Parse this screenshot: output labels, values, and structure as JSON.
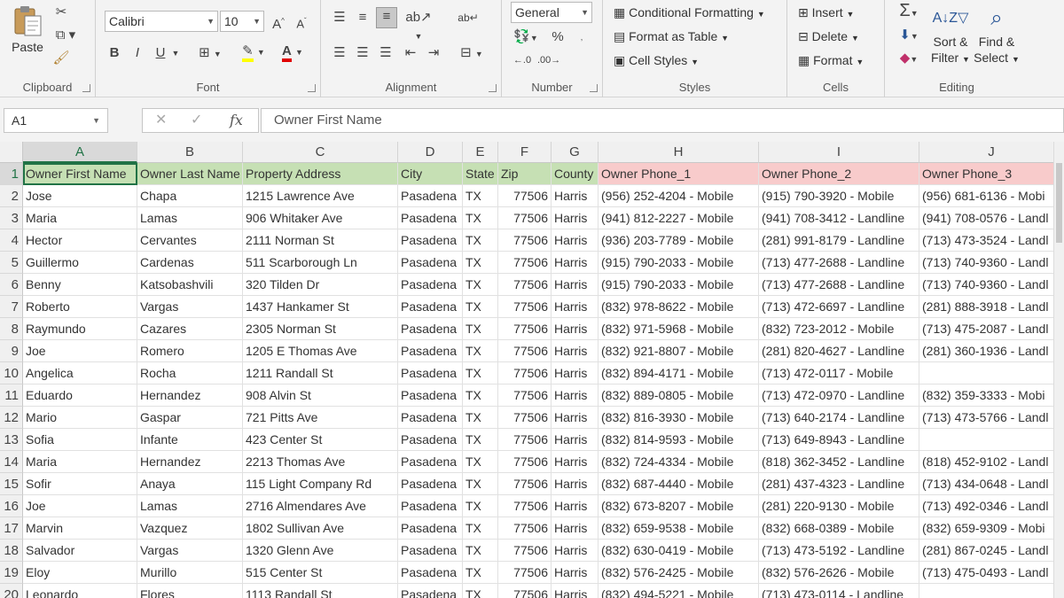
{
  "ribbon": {
    "clipboard": {
      "paste": "Paste",
      "label": "Clipboard"
    },
    "font": {
      "name": "Calibri",
      "size": "10",
      "bold": "B",
      "italic": "I",
      "underline": "U",
      "label": "Font"
    },
    "alignment": {
      "label": "Alignment"
    },
    "number": {
      "format": "General",
      "label": "Number"
    },
    "styles": {
      "conditional": "Conditional Formatting",
      "table": "Format as Table",
      "cell": "Cell Styles",
      "label": "Styles"
    },
    "cells": {
      "insert": "Insert",
      "delete": "Delete",
      "format": "Format",
      "label": "Cells"
    },
    "editing": {
      "sort1": "Sort &",
      "sort2": "Filter",
      "find1": "Find &",
      "find2": "Select",
      "label": "Editing"
    }
  },
  "formula_bar": {
    "name_box": "A1",
    "content": "Owner First Name"
  },
  "columns": [
    "A",
    "B",
    "C",
    "D",
    "E",
    "F",
    "G",
    "H",
    "I",
    "J"
  ],
  "headers": [
    "Owner First Name",
    "Owner Last Name",
    "Property Address",
    "City",
    "State",
    "Zip",
    "County",
    "Owner Phone_1",
    "Owner Phone_2",
    "Owner Phone_3"
  ],
  "rows": [
    [
      "2",
      "Jose",
      "Chapa",
      "1215 Lawrence Ave",
      "Pasadena",
      "TX",
      "77506",
      "Harris",
      "(956) 252-4204 - Mobile",
      "(915) 790-3920 - Mobile",
      "(956) 681-6136 - Mobi"
    ],
    [
      "3",
      "Maria",
      "Lamas",
      "906 Whitaker Ave",
      "Pasadena",
      "TX",
      "77506",
      "Harris",
      "(941) 812-2227 - Mobile",
      "(941) 708-3412 - Landline",
      "(941) 708-0576 - Landl"
    ],
    [
      "4",
      "Hector",
      "Cervantes",
      "2111 Norman St",
      "Pasadena",
      "TX",
      "77506",
      "Harris",
      "(936) 203-7789 - Mobile",
      "(281) 991-8179 - Landline",
      "(713) 473-3524 - Landl"
    ],
    [
      "5",
      "Guillermo",
      "Cardenas",
      "511 Scarborough Ln",
      "Pasadena",
      "TX",
      "77506",
      "Harris",
      "(915) 790-2033 - Mobile",
      "(713) 477-2688 - Landline",
      "(713) 740-9360 - Landl"
    ],
    [
      "6",
      "Benny",
      "Katsobashvili",
      "320 Tilden Dr",
      "Pasadena",
      "TX",
      "77506",
      "Harris",
      "(915) 790-2033 - Mobile",
      "(713) 477-2688 - Landline",
      "(713) 740-9360 - Landl"
    ],
    [
      "7",
      "Roberto",
      "Vargas",
      "1437 Hankamer St",
      "Pasadena",
      "TX",
      "77506",
      "Harris",
      "(832) 978-8622 - Mobile",
      "(713) 472-6697 - Landline",
      "(281) 888-3918 - Landl"
    ],
    [
      "8",
      "Raymundo",
      "Cazares",
      "2305 Norman St",
      "Pasadena",
      "TX",
      "77506",
      "Harris",
      "(832) 971-5968 - Mobile",
      "(832) 723-2012 - Mobile",
      "(713) 475-2087 - Landl"
    ],
    [
      "9",
      "Joe",
      "Romero",
      "1205 E Thomas Ave",
      "Pasadena",
      "TX",
      "77506",
      "Harris",
      "(832) 921-8807 - Mobile",
      "(281) 820-4627 - Landline",
      "(281) 360-1936 - Landl"
    ],
    [
      "10",
      "Angelica",
      "Rocha",
      "1211 Randall St",
      "Pasadena",
      "TX",
      "77506",
      "Harris",
      "(832) 894-4171 - Mobile",
      "(713) 472-0117 - Mobile",
      ""
    ],
    [
      "11",
      "Eduardo",
      "Hernandez",
      "908 Alvin St",
      "Pasadena",
      "TX",
      "77506",
      "Harris",
      "(832) 889-0805 - Mobile",
      "(713) 472-0970 - Landline",
      "(832) 359-3333 - Mobi"
    ],
    [
      "12",
      "Mario",
      "Gaspar",
      "721 Pitts Ave",
      "Pasadena",
      "TX",
      "77506",
      "Harris",
      "(832) 816-3930 - Mobile",
      "(713) 640-2174 - Landline",
      "(713) 473-5766 - Landl"
    ],
    [
      "13",
      "Sofia",
      "Infante",
      "423 Center St",
      "Pasadena",
      "TX",
      "77506",
      "Harris",
      "(832) 814-9593 - Mobile",
      "(713) 649-8943 - Landline",
      ""
    ],
    [
      "14",
      "Maria",
      "Hernandez",
      "2213 Thomas Ave",
      "Pasadena",
      "TX",
      "77506",
      "Harris",
      "(832) 724-4334 - Mobile",
      "(818) 362-3452 - Landline",
      "(818) 452-9102 - Landl"
    ],
    [
      "15",
      "Sofir",
      "Anaya",
      "115 Light Company Rd",
      "Pasadena",
      "TX",
      "77506",
      "Harris",
      "(832) 687-4440 - Mobile",
      "(281) 437-4323 - Landline",
      "(713) 434-0648 - Landl"
    ],
    [
      "16",
      "Joe",
      "Lamas",
      "2716 Almendares Ave",
      "Pasadena",
      "TX",
      "77506",
      "Harris",
      "(832) 673-8207 - Mobile",
      "(281) 220-9130 - Mobile",
      "(713) 492-0346 - Landl"
    ],
    [
      "17",
      "Marvin",
      "Vazquez",
      "1802 Sullivan Ave",
      "Pasadena",
      "TX",
      "77506",
      "Harris",
      "(832) 659-9538 - Mobile",
      "(832) 668-0389 - Mobile",
      "(832) 659-9309 - Mobi"
    ],
    [
      "18",
      "Salvador",
      "Vargas",
      "1320 Glenn Ave",
      "Pasadena",
      "TX",
      "77506",
      "Harris",
      "(832) 630-0419 - Mobile",
      "(713) 473-5192 - Landline",
      "(281) 867-0245 - Landl"
    ],
    [
      "19",
      "Eloy",
      "Murillo",
      "515 Center St",
      "Pasadena",
      "TX",
      "77506",
      "Harris",
      "(832) 576-2425 - Mobile",
      "(832) 576-2626 - Mobile",
      "(713) 475-0493 - Landl"
    ],
    [
      "20",
      "Leonardo",
      "Flores",
      "1113 Randall St",
      "Pasadena",
      "TX",
      "77506",
      "Harris",
      "(832) 494-5221 - Mobile",
      "(713) 473-0114 - Landline",
      ""
    ]
  ],
  "colors": {
    "header_green": "#c6e0b4",
    "header_pink": "#f8cbcb",
    "select_green": "#217346"
  }
}
